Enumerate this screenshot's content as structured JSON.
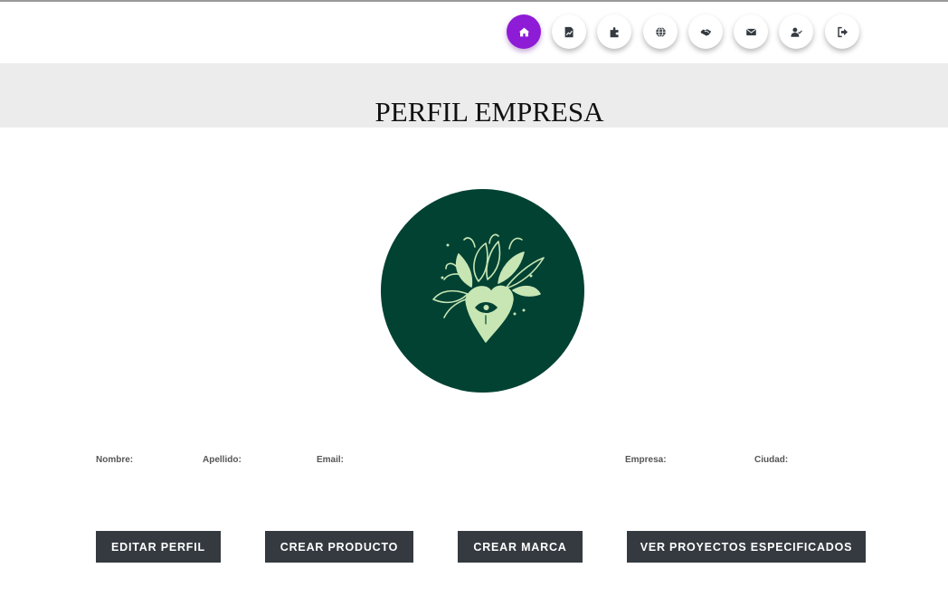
{
  "page_title": "PERFIL EMPRESA",
  "nav": {
    "active_color": "#8e1bd6",
    "items": [
      {
        "icon": "home-icon",
        "active": true
      },
      {
        "icon": "chart-document-icon",
        "active": false
      },
      {
        "icon": "puzzle-icon",
        "active": false
      },
      {
        "icon": "globe-icon",
        "active": false
      },
      {
        "icon": "handshake-icon",
        "active": false
      },
      {
        "icon": "envelope-icon",
        "active": false
      },
      {
        "icon": "user-check-icon",
        "active": false
      },
      {
        "icon": "sign-out-icon",
        "active": false
      }
    ]
  },
  "profile": {
    "avatar_bg": "#024233",
    "avatar_art": "heart-with-eye-and-leaves-logo",
    "fields": {
      "nombre_label": "Nombre:",
      "apellido_label": "Apellido:",
      "email_label": "Email:",
      "empresa_label": "Empresa:",
      "ciudad_label": "Ciudad:"
    }
  },
  "actions": {
    "edit_profile": "EDITAR PERFIL",
    "create_product": "CREAR PRODUCTO",
    "create_brand": "CREAR MARCA",
    "view_projects": "VER PROYECTOS ESPECIFICADOS"
  }
}
